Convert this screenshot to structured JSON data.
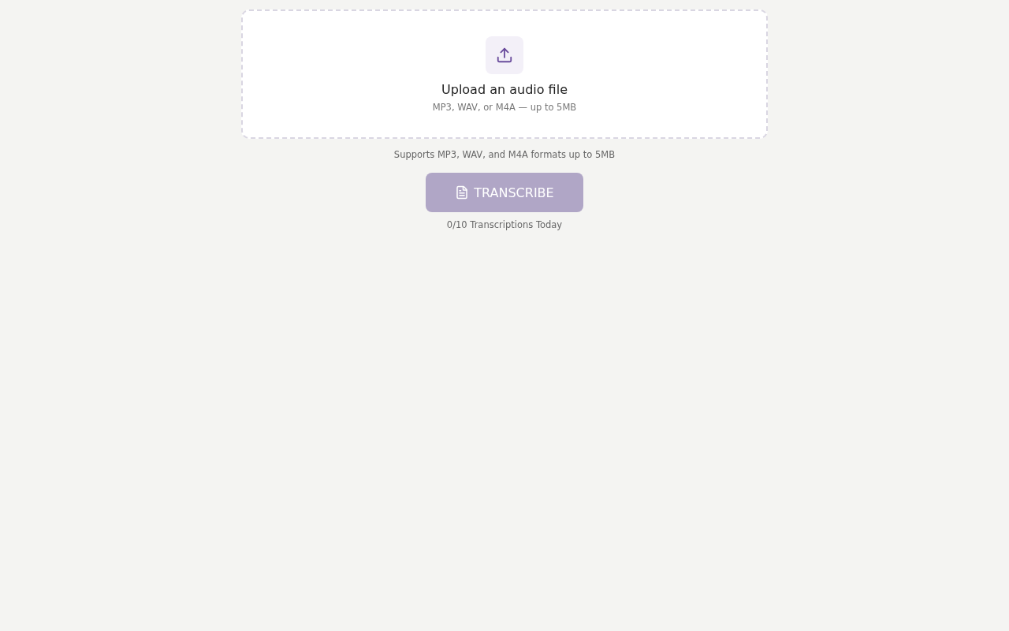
{
  "dropzone": {
    "title": "Upload an audio file",
    "hint": "MP3, WAV, or M4A — up to 5MB"
  },
  "formats_note": "Supports MP3, WAV, and M4A formats up to 5MB",
  "transcribe_button": {
    "label": "TRANSCRIBE",
    "disabled": true
  },
  "usage": "0/10 Transcriptions Today"
}
